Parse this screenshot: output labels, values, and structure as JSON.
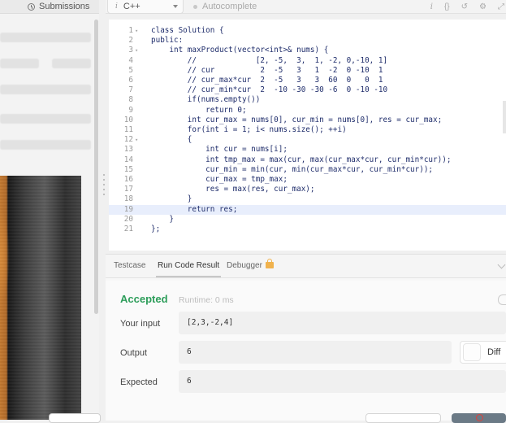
{
  "left": {
    "submissions_label": "Submissions"
  },
  "toolbar": {
    "language": "C++",
    "autocomplete": "Autocomplete",
    "icons": [
      "info-icon",
      "braces-icon",
      "reset-icon",
      "settings-icon",
      "expand-icon"
    ]
  },
  "code": {
    "lines": [
      {
        "n": "1",
        "fold": "▾",
        "text": "class Solution {"
      },
      {
        "n": "2",
        "fold": "",
        "text": "public:"
      },
      {
        "n": "3",
        "fold": "▾",
        "text": "    int maxProduct(vector<int>& nums) {"
      },
      {
        "n": "4",
        "fold": "",
        "text": "        //             [2, -5,  3,  1, -2, 0,-10, 1]"
      },
      {
        "n": "5",
        "fold": "",
        "text": "        // cur          2  -5   3   1  -2  0 -10  1"
      },
      {
        "n": "6",
        "fold": "",
        "text": "        // cur_max*cur  2  -5   3   3  60  0   0  1"
      },
      {
        "n": "7",
        "fold": "",
        "text": "        // cur_min*cur  2  -10 -30 -30 -6  0 -10 -10"
      },
      {
        "n": "8",
        "fold": "",
        "text": "        if(nums.empty())"
      },
      {
        "n": "9",
        "fold": "",
        "text": "            return 0;"
      },
      {
        "n": "10",
        "fold": "",
        "text": "        int cur_max = nums[0], cur_min = nums[0], res = cur_max;"
      },
      {
        "n": "11",
        "fold": "",
        "text": "        for(int i = 1; i< nums.size(); ++i)"
      },
      {
        "n": "12",
        "fold": "▾",
        "text": "        {"
      },
      {
        "n": "13",
        "fold": "",
        "text": "            int cur = nums[i];"
      },
      {
        "n": "14",
        "fold": "",
        "text": "            int tmp_max = max(cur, max(cur_max*cur, cur_min*cur));"
      },
      {
        "n": "15",
        "fold": "",
        "text": "            cur_min = min(cur, min(cur_max*cur, cur_min*cur));"
      },
      {
        "n": "16",
        "fold": "",
        "text": "            cur_max = tmp_max;"
      },
      {
        "n": "17",
        "fold": "",
        "text": "            res = max(res, cur_max);"
      },
      {
        "n": "18",
        "fold": "",
        "text": "        }"
      },
      {
        "n": "19",
        "fold": "",
        "text": "        return res;"
      },
      {
        "n": "20",
        "fold": "",
        "text": "    }"
      },
      {
        "n": "21",
        "fold": "",
        "text": "};"
      }
    ],
    "active_line": 19
  },
  "panel": {
    "tabs": [
      "Testcase",
      "Run Code Result",
      "Debugger"
    ],
    "active_tab": "Run Code Result",
    "status": "Accepted",
    "runtime": "Runtime: 0 ms",
    "input_label": "Your input",
    "input_value": "[2,3,-2,4]",
    "output_label": "Output",
    "output_value": "6",
    "expected_label": "Expected",
    "expected_value": "6",
    "diff_label": "Diff"
  },
  "colors": {
    "accepted": "#2d9d5a",
    "lock": "#f0b24d",
    "submit": "#6b7a86"
  }
}
